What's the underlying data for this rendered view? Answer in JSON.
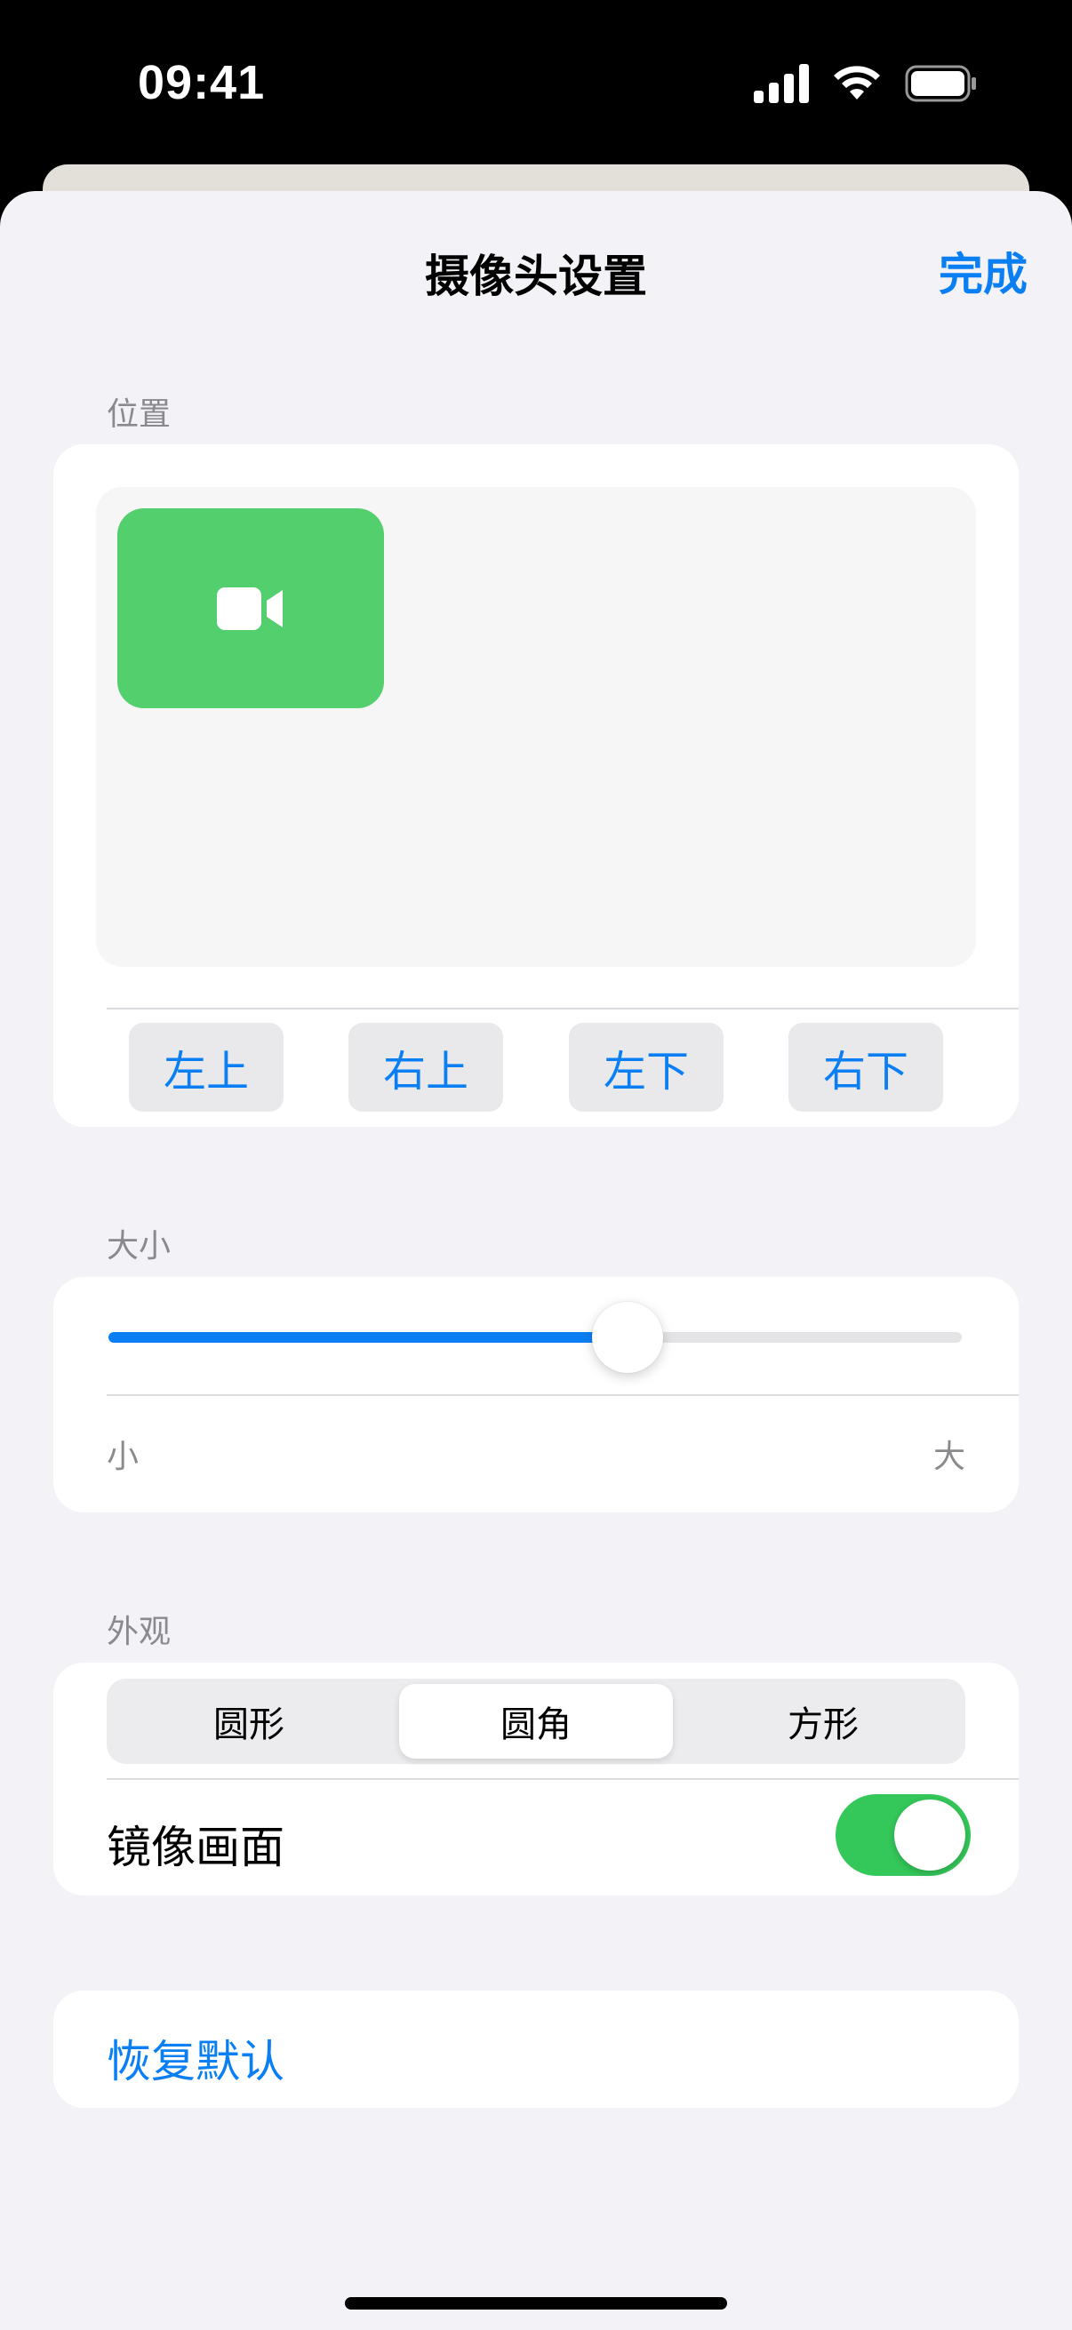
{
  "status_bar": {
    "time": "09:41"
  },
  "sheet": {
    "title": "摄像头设置",
    "done_label": "完成"
  },
  "position": {
    "section_label": "位置",
    "buttons": [
      "左上",
      "右上",
      "左下",
      "右下"
    ],
    "selected": "左上"
  },
  "size": {
    "section_label": "大小",
    "min_label": "小",
    "max_label": "大",
    "value": 0.608
  },
  "appearance": {
    "section_label": "外观",
    "shapes": [
      "圆形",
      "圆角",
      "方形"
    ],
    "selected_index": 1,
    "mirror_label": "镜像画面",
    "mirror_on": true
  },
  "reset": {
    "label": "恢复默认"
  },
  "colors": {
    "accent": "#0a7ff3",
    "camera_tile": "#54cf6d",
    "toggle_on": "#34c759",
    "background": "#f2f2f7"
  }
}
